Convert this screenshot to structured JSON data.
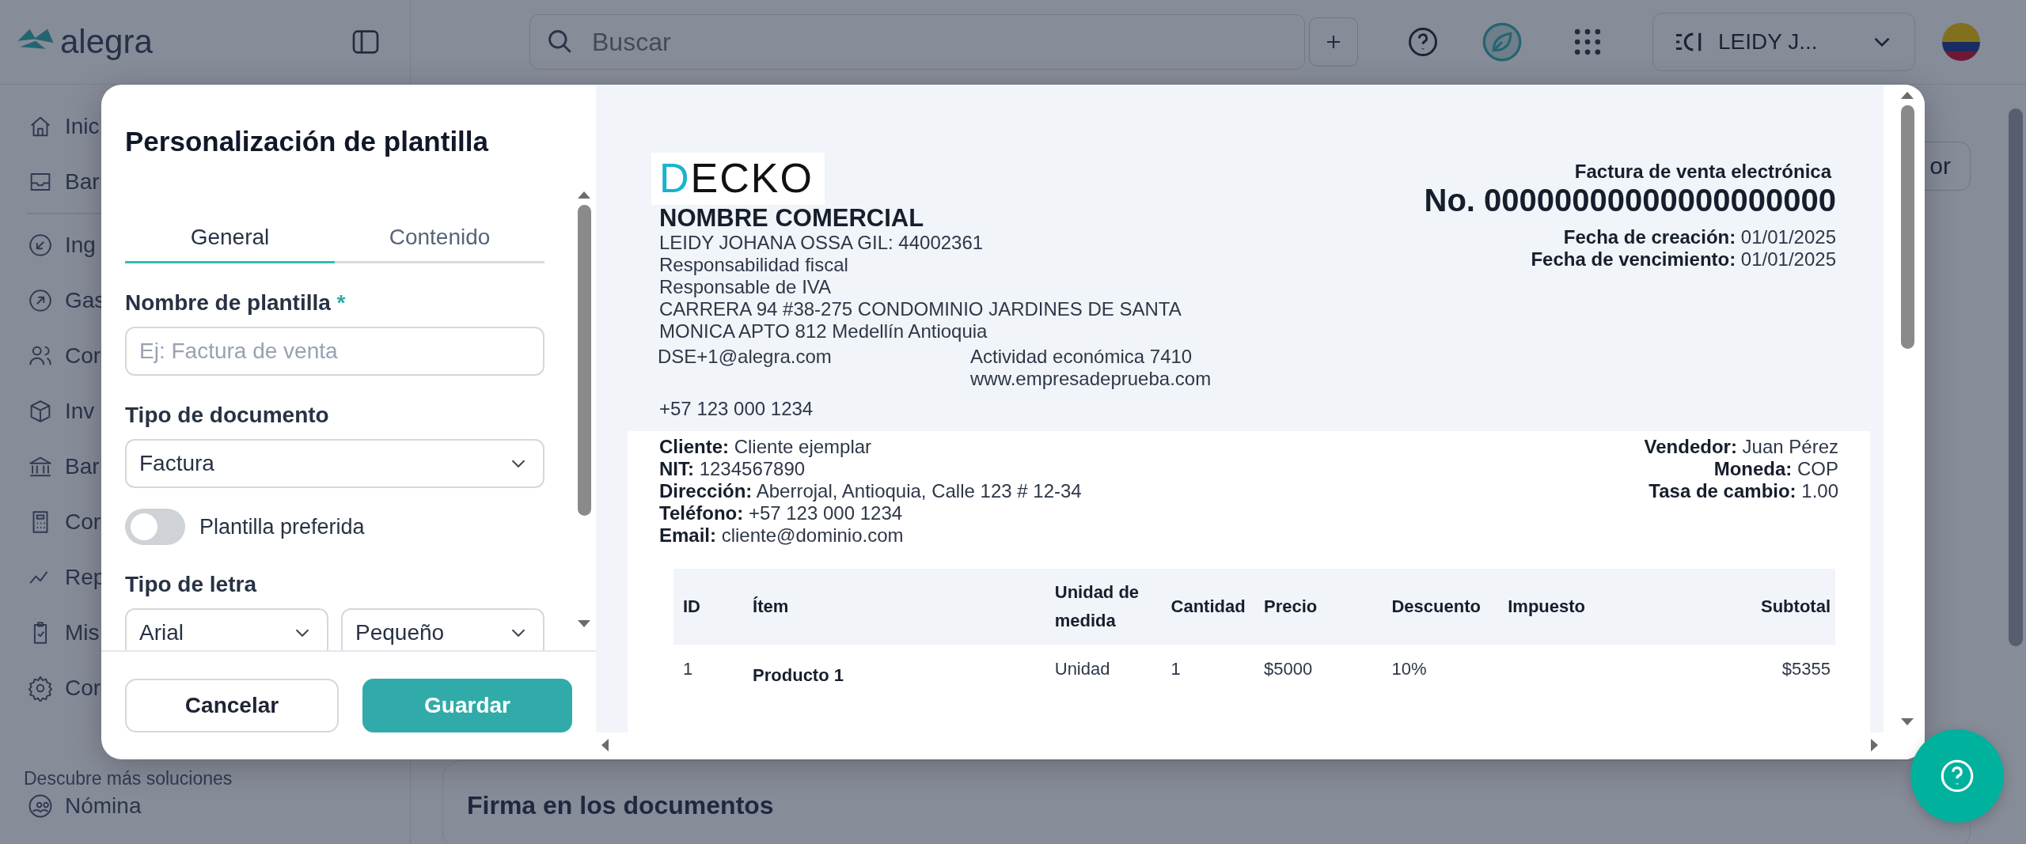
{
  "topbar": {
    "logo": "alegra",
    "search": {
      "placeholder": "Buscar"
    },
    "account": {
      "name": "LEIDY J..."
    }
  },
  "sidebar": {
    "groups": [
      {
        "items": [
          {
            "label": "Inic"
          },
          {
            "label": "Bar"
          }
        ]
      },
      {
        "items": [
          {
            "label": "Ing"
          },
          {
            "label": "Gas"
          },
          {
            "label": "Cor"
          },
          {
            "label": "Inv"
          },
          {
            "label": "Bar"
          },
          {
            "label": "Cor"
          },
          {
            "label": "Rep"
          },
          {
            "label": "Mis"
          },
          {
            "label": "Cor"
          }
        ]
      }
    ],
    "section_title": "Descubre más soluciones",
    "extra_items": [
      {
        "label": "Nómina"
      }
    ]
  },
  "main": {
    "button": "or",
    "card_title": "Firma en los documentos"
  },
  "modal": {
    "title": "Personalización de plantilla",
    "tabs": [
      {
        "label": "General",
        "selected": true
      },
      {
        "label": "Contenido",
        "selected": false
      }
    ],
    "name_field": {
      "label": "Nombre de plantilla",
      "required_mark": "*",
      "placeholder": "Ej: Factura de venta"
    },
    "document_type": {
      "label": "Tipo de documento",
      "value": "Factura"
    },
    "preferred": {
      "label": "Plantilla preferida",
      "on": false
    },
    "font": {
      "label": "Tipo de letra",
      "family": "Arial",
      "size": "Pequeño"
    },
    "buttons": {
      "cancel": "Cancelar",
      "save": "Guardar"
    }
  },
  "invoice": {
    "logo": "DECKO",
    "company": {
      "name": "NOMBRE COMERCIAL",
      "lines": [
        "LEIDY JOHANA OSSA GIL: 44002361",
        "Responsabilidad fiscal",
        "Responsable de IVA",
        "CARRERA 94 #38-275 CONDOMINIO JARDINES DE SANTA MONICA APTO 812 Medellín Antioquia"
      ],
      "email": "DSE+1@alegra.com",
      "activity": "Actividad económica 7410",
      "website": "www.empresadeprueba.com",
      "phone": "+57 123 000 1234"
    },
    "doc_type": "Factura de venta electrónica",
    "number": "No. 00000000000000000000",
    "dates": [
      {
        "label": "Fecha de creación:",
        "value": "01/01/2025"
      },
      {
        "label": "Fecha de vencimiento:",
        "value": "01/01/2025"
      }
    ],
    "client": [
      {
        "label": "Cliente:",
        "value": "Cliente ejemplar"
      },
      {
        "label": "NIT:",
        "value": "1234567890"
      },
      {
        "label": "Dirección:",
        "value": "Aberrojal, Antioquia, Calle 123 # 12-34"
      },
      {
        "label": "Teléfono:",
        "value": "+57 123 000 1234"
      },
      {
        "label": "Email:",
        "value": "cliente@dominio.com"
      }
    ],
    "seller": [
      {
        "label": "Vendedor:",
        "value": "Juan Pérez"
      },
      {
        "label": "Moneda:",
        "value": "COP"
      },
      {
        "label": "Tasa de cambio:",
        "value": "1.00"
      }
    ],
    "table": {
      "columns": [
        "ID",
        "Ítem",
        "Unidad de medida",
        "Cantidad",
        "Precio",
        "Descuento",
        "Impuesto",
        "Subtotal"
      ],
      "rows": [
        [
          "1",
          "Producto 1",
          "Unidad",
          "1",
          "$5000",
          "10%",
          "",
          "$5355"
        ]
      ]
    }
  }
}
